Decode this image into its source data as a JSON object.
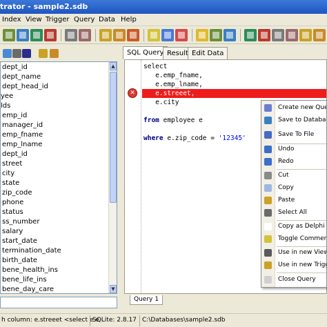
{
  "window": {
    "title": "trator - sample2.sdb"
  },
  "menu": [
    "Index",
    "View",
    "Trigger",
    "Query",
    "Data",
    "Help"
  ],
  "toolbar": {
    "buttons": [
      {
        "icon": "table-icon",
        "color": "#6b8f3a"
      },
      {
        "icon": "table-grid-icon",
        "color": "#3a7fbf"
      },
      {
        "icon": "table-edit-icon",
        "color": "#2e8b57"
      },
      {
        "icon": "table-delete-icon",
        "color": "#b83a2e"
      },
      {
        "icon": "index-icon",
        "color": "#7a7a7a"
      },
      {
        "icon": "index-delete-icon",
        "color": "#9a6a6a"
      },
      {
        "icon": "view-icon",
        "color": "#c9a227"
      },
      {
        "icon": "view-edit-icon",
        "color": "#c98a27"
      },
      {
        "icon": "view-delete-icon",
        "color": "#c95a27"
      },
      {
        "icon": "trigger-icon",
        "color": "#d4c23a"
      },
      {
        "icon": "trigger-edit-icon",
        "color": "#4a7ad4"
      },
      {
        "icon": "trigger-delete-icon",
        "color": "#d44a4a"
      },
      {
        "icon": "query-icon",
        "color": "#e0b82c"
      }
    ]
  },
  "schema_toolbar": {
    "buttons": [
      {
        "icon": "refresh-icon",
        "color": "#4a8ad4"
      },
      {
        "icon": "expand-icon",
        "color": "#6a6a6a"
      },
      {
        "icon": "db-icon",
        "color": "#2c2c8c"
      },
      {
        "icon": "table-icon",
        "color": "#c9a227"
      },
      {
        "icon": "view-icon",
        "color": "#c98a27"
      }
    ]
  },
  "tree": {
    "items": [
      "dept_id",
      "dept_name",
      "dept_head_id",
      "yee",
      "lds",
      "emp_id",
      "manager_id",
      "emp_fname",
      "emp_lname",
      "dept_id",
      "street",
      "city",
      "state",
      "zip_code",
      "phone",
      "status",
      "ss_number",
      "salary",
      "start_date",
      "termination_date",
      "birth_date",
      "bene_health_ins",
      "bene_life_ins",
      "bene_day_care"
    ]
  },
  "tabs": [
    "SQL Query",
    "Result",
    "Edit Data"
  ],
  "active_tab": "SQL Query",
  "editor": {
    "line1": "select",
    "line2": "   e.emp_fname,",
    "line3": "   e.emp_lname,",
    "line4": "   e.streeet,",
    "line5": "   e.city",
    "line7_kw1": "from",
    "line7_rest": " employee e",
    "line9_kw": "where",
    "line9_rest": " e.zip_code = ",
    "line9_str": "'12345'",
    "error_color": "#ee1c1c"
  },
  "context_menu": {
    "items": [
      {
        "label": "Create new Query",
        "icon": "new-query-icon"
      },
      {
        "label": "Save to Database",
        "icon": "save-db-icon"
      },
      {
        "label": "Save To File",
        "icon": "save-file-icon"
      },
      {
        "label": "Undo",
        "icon": "undo-icon"
      },
      {
        "label": "Redo",
        "icon": "redo-icon"
      },
      {
        "label": "Cut",
        "icon": "cut-icon"
      },
      {
        "label": "Copy",
        "icon": "copy-icon"
      },
      {
        "label": "Paste",
        "icon": "paste-icon"
      },
      {
        "label": "Select All",
        "icon": "select-all-icon"
      },
      {
        "label": "Copy as Delphi Sou",
        "icon": "delphi-icon"
      },
      {
        "label": "Toggle Comment",
        "icon": "comment-icon"
      },
      {
        "label": "Use in new View",
        "icon": "view-icon"
      },
      {
        "label": "Use in new Trigger",
        "icon": "trigger-icon"
      },
      {
        "label": "Close Query",
        "icon": "close-icon"
      }
    ]
  },
  "query_tab": "Query 1",
  "status": {
    "left": "h column: e.streeet   <select   e.e",
    "version": "SQLite: 2.8.17",
    "path": "C:\\Databases\\sample2.sdb"
  }
}
